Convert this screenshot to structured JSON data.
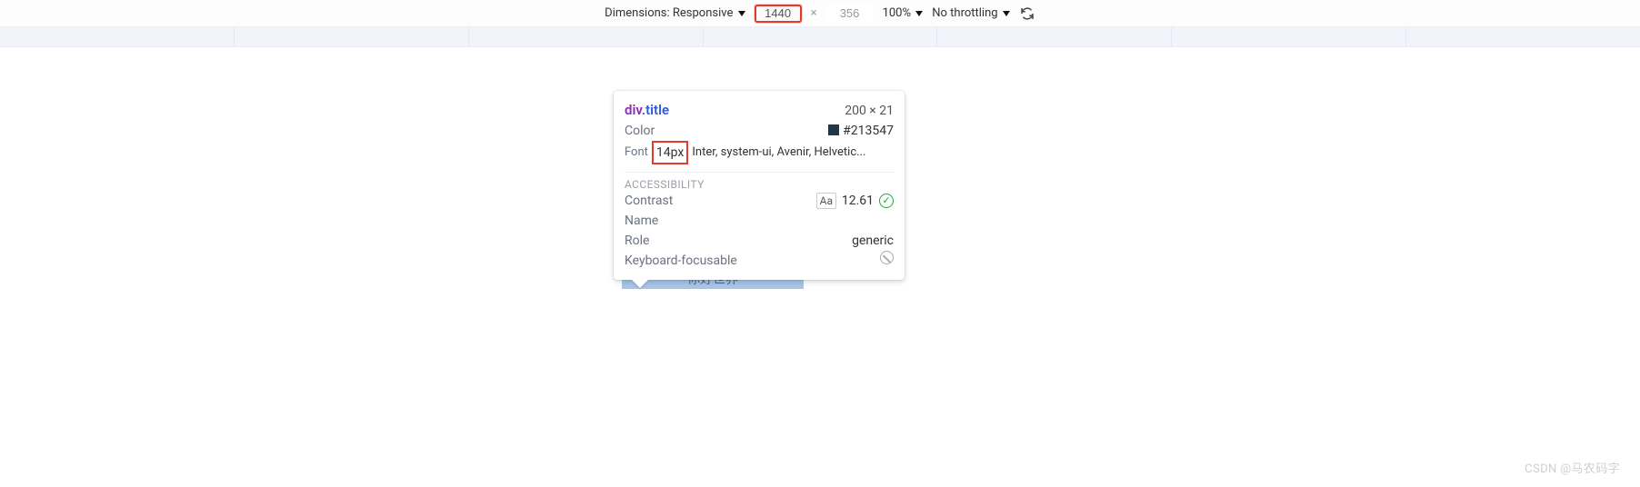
{
  "toolbar": {
    "dimensions_label": "Dimensions: Responsive",
    "width_value": "1440",
    "height_value": "356",
    "times": "×",
    "zoom": "100%",
    "throttling": "No throttling"
  },
  "tooltip": {
    "tag": "div",
    "class": ".title",
    "dimensions": "200 × 21",
    "color_label": "Color",
    "color_value": "#213547",
    "font_label": "Font",
    "font_size": "14px",
    "font_rest": "Inter, system-ui, Avenir, Helvetic...",
    "accessibility_heading": "ACCESSIBILITY",
    "contrast_label": "Contrast",
    "contrast_badge": "Aa",
    "contrast_value": "12.61",
    "name_label": "Name",
    "role_label": "Role",
    "role_value": "generic",
    "keyboard_label": "Keyboard-focusable"
  },
  "inspected": {
    "text": "你好世界"
  },
  "watermark": "CSDN @马农码字"
}
